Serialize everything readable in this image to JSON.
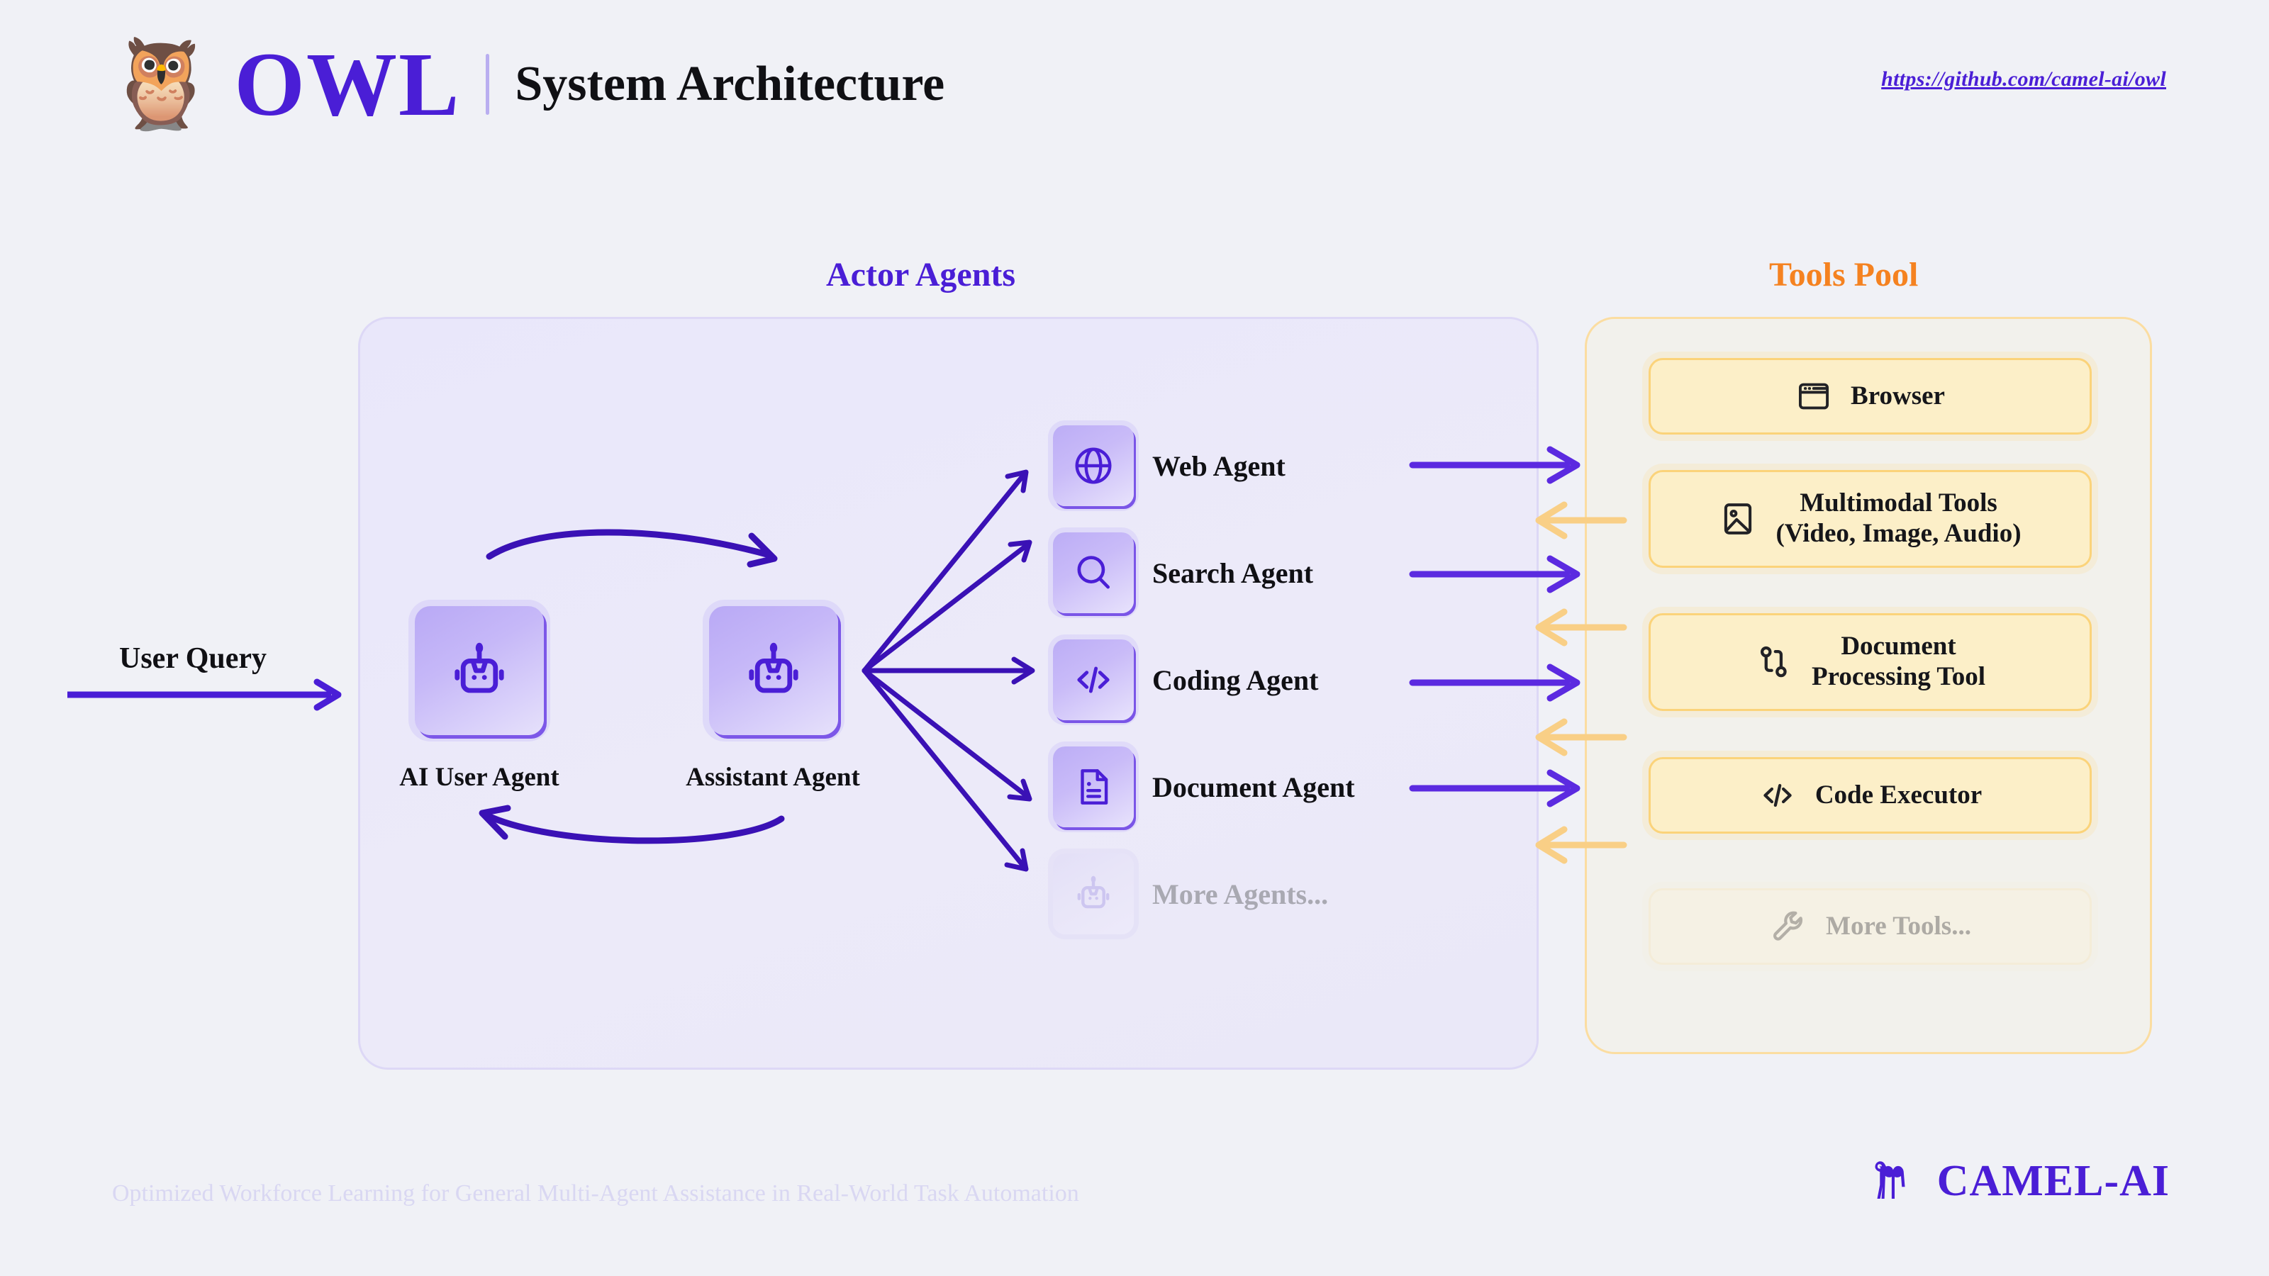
{
  "header": {
    "owl_icon": "owl-emoji",
    "brand": "OWL",
    "title": "System Architecture",
    "repo_url": "https://github.com/camel-ai/owl"
  },
  "sections": {
    "actor_agents_title": "Actor Agents",
    "tools_pool_title": "Tools Pool"
  },
  "flow": {
    "user_query_label": "User Query"
  },
  "core_agents": [
    {
      "id": "ai-user-agent",
      "label": "AI User Agent",
      "icon": "robot-icon"
    },
    {
      "id": "assistant-agent",
      "label": "Assistant Agent",
      "icon": "robot-icon"
    }
  ],
  "actor_agents": [
    {
      "id": "web-agent",
      "label": "Web Agent",
      "icon": "globe-icon",
      "muted": false
    },
    {
      "id": "search-agent",
      "label": "Search Agent",
      "icon": "search-icon",
      "muted": false
    },
    {
      "id": "coding-agent",
      "label": "Coding Agent",
      "icon": "code-icon",
      "muted": false
    },
    {
      "id": "document-agent",
      "label": "Document Agent",
      "icon": "document-icon",
      "muted": false
    },
    {
      "id": "more-agents",
      "label": "More Agents...",
      "icon": "robot-icon",
      "muted": true
    }
  ],
  "tools": [
    {
      "id": "browser",
      "label": "Browser",
      "icon": "browser-window-icon",
      "muted": false
    },
    {
      "id": "multimodal-tools",
      "label": "Multimodal Tools",
      "label2": "(Video, Image, Audio)",
      "icon": "image-icon",
      "muted": false
    },
    {
      "id": "document-processing-tool",
      "label": "Document",
      "label2": "Processing Tool",
      "icon": "git-branch-icon",
      "muted": false
    },
    {
      "id": "code-executor",
      "label": "Code Executor",
      "icon": "code-icon",
      "muted": false
    },
    {
      "id": "more-tools",
      "label": "More Tools...",
      "icon": "wrench-icon",
      "muted": true
    }
  ],
  "footer": {
    "tagline": "Optimized Workforce Learning for General Multi-Agent Assistance in Real-World Task Automation",
    "brand": "CAMEL-AI",
    "brand_icon": "camel-icon"
  },
  "colors": {
    "background": "#f0f1f6",
    "purple": "#4a1ed6",
    "purple_deep": "#5b2ae0",
    "orange": "#f58220",
    "amber_arrow": "#f9cf86",
    "panel_actor": "#eceaf9",
    "panel_tools": "#f2f1ec",
    "tool_card": "#fcefc8",
    "muted_text": "#a9a9b2"
  }
}
